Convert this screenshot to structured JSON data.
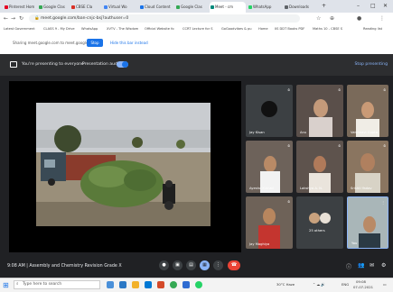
{
  "browser": {
    "tabs": [
      {
        "label": "Pinterest Hom",
        "color": "#e60023"
      },
      {
        "label": "Google Clas",
        "color": "#34a853"
      },
      {
        "label": "CBSE Cla",
        "color": "#d93025"
      },
      {
        "label": "Virtual Wo",
        "color": "#4285f4"
      },
      {
        "label": "Cloud Content",
        "color": "#1a73e8"
      },
      {
        "label": "Google Clas",
        "color": "#34a853"
      },
      {
        "label": "Meet - cm",
        "color": "#00897b"
      },
      {
        "label": "WhatsApp",
        "color": "#25d366"
      },
      {
        "label": "Downloads",
        "color": "#5f6368"
      }
    ],
    "new_tab": "+",
    "url": "meet.google.com/ban-cnjc-bsj?authuser=0",
    "bookmarks": [
      "Latest Government",
      "CLASS 9 - My Drive",
      "WhatsApp",
      "XVTV - The Wisdom",
      "Official Website fo",
      "CCRT Lecture for S",
      "GoGoodvibes & pu",
      "Home",
      "IIS DDT Books PDF",
      "Maths 10 - CBSE S",
      "Reading list"
    ],
    "share_prompt": "Sharing meet.google.com to meet.google.com",
    "share_button": "Stop",
    "hide_button": "Hide this bar instead"
  },
  "meet": {
    "presenting_text": "You're presenting to everyone",
    "audio_label": "Presentation audio",
    "stop_presenting": "Stop presenting",
    "meeting_time": "9:08 AM",
    "meeting_title": "Assembly and Chemistry Revision Grade X",
    "participants": [
      {
        "name": "Jay Kisan",
        "bg": "#3c4043"
      },
      {
        "name": "Anu",
        "bg": "#5a4f4a"
      },
      {
        "name": "Vaishnavi Gupta",
        "bg": "#7a6a5a"
      },
      {
        "name": "Ayesha Kumari",
        "bg": "#6d625a"
      },
      {
        "name": "Lakshya A. N.",
        "bg": "#5e534d"
      },
      {
        "name": "Srishti Yadav",
        "bg": "#8a7560"
      },
      {
        "name": "Jay Maghiya",
        "bg": "#6e6258"
      },
      {
        "name": "25 others",
        "bg": "#3c4043"
      },
      {
        "name": "You",
        "bg": "#7b8a8f"
      }
    ]
  },
  "taskbar": {
    "search_placeholder": "Type here to search",
    "weather": "30°C Haze",
    "lang": "ENG",
    "clock_time": "09:08",
    "clock_date": "07-07-2021"
  },
  "icons": [
    "windows-start-icon",
    "search-icon",
    "mic-icon",
    "camera-icon",
    "captions-icon",
    "raise-hand-icon",
    "present-icon",
    "more-icon",
    "hang-up-icon",
    "info-icon",
    "people-icon",
    "chat-icon",
    "activities-icon"
  ]
}
